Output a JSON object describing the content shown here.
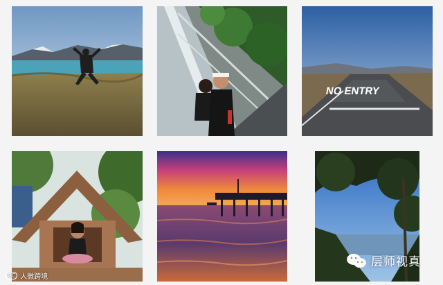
{
  "photos": [
    {
      "id": "mountain-lake-jump"
    },
    {
      "id": "glass-walkway-selfie"
    },
    {
      "id": "no-entry-road",
      "road_text": "NO ENTRY"
    },
    {
      "id": "wooden-hut-portrait"
    },
    {
      "id": "sunset-pier"
    },
    {
      "id": "coast-tree-view"
    }
  ],
  "watermarks": {
    "left_cc": "CC",
    "left_text": "人微跨境",
    "right_text": "层师视真",
    "right_icon": "wechat-icon"
  },
  "colors": {
    "background": "#f4f4f4",
    "sky_blue": "#5f93c9",
    "sunset_orange": "#e86a3a"
  }
}
